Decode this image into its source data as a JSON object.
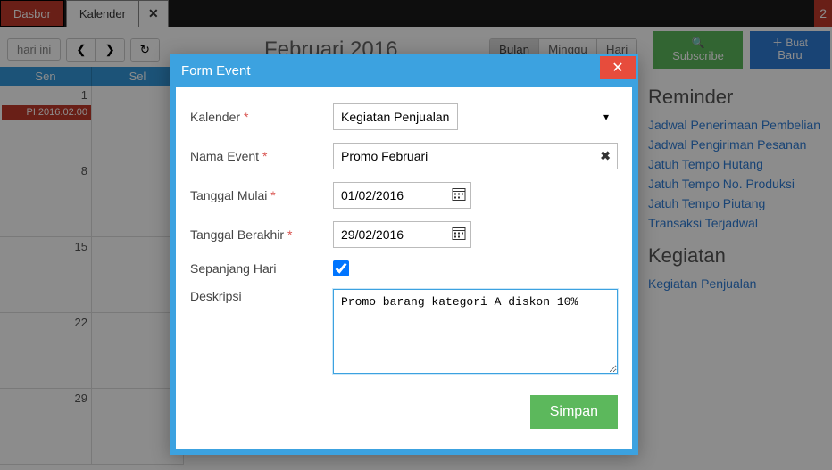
{
  "tabs": {
    "dashboard": "Dasbor",
    "calendar": "Kalender",
    "close": "✕"
  },
  "toolbar": {
    "today": "hari ini",
    "prev": "❮",
    "next": "❯",
    "refresh": "↻",
    "title": "Februari 2016",
    "view_month": "Bulan",
    "view_week": "Minggu",
    "view_day": "Hari",
    "subscribe": "Subscribe",
    "new": "Buat Baru"
  },
  "calendar": {
    "days": [
      "Sen",
      "Sel"
    ],
    "rows": [
      {
        "cells": [
          "1",
          ""
        ],
        "event": "PI.2016.02.00"
      },
      {
        "cells": [
          "8",
          ""
        ]
      },
      {
        "cells": [
          "15",
          ""
        ]
      },
      {
        "cells": [
          "22",
          ""
        ]
      },
      {
        "cells": [
          "29",
          ""
        ]
      }
    ]
  },
  "sidebar": {
    "reminder_title": "Reminder",
    "reminders": [
      "Jadwal Penerimaan Pembelian",
      "Jadwal Pengiriman Pesanan",
      "Jatuh Tempo Hutang",
      "Jatuh Tempo No. Produksi",
      "Jatuh Tempo Piutang",
      "Transaksi Terjadwal"
    ],
    "kegiatan_title": "Kegiatan",
    "kegiatan": [
      "Kegiatan Penjualan"
    ]
  },
  "modal": {
    "title": "Form Event",
    "close": "✕",
    "labels": {
      "kalender": "Kalender",
      "nama": "Nama Event",
      "mulai": "Tanggal Mulai",
      "berakhir": "Tanggal Berakhir",
      "sepanjang": "Sepanjang Hari",
      "deskripsi": "Deskripsi"
    },
    "values": {
      "kalender": "Kegiatan Penjualan",
      "nama": "Promo Februari",
      "mulai": "01/02/2016",
      "berakhir": "29/02/2016",
      "sepanjang": true,
      "deskripsi": "Promo barang kategori A diskon 10%"
    },
    "save": "Simpan"
  }
}
